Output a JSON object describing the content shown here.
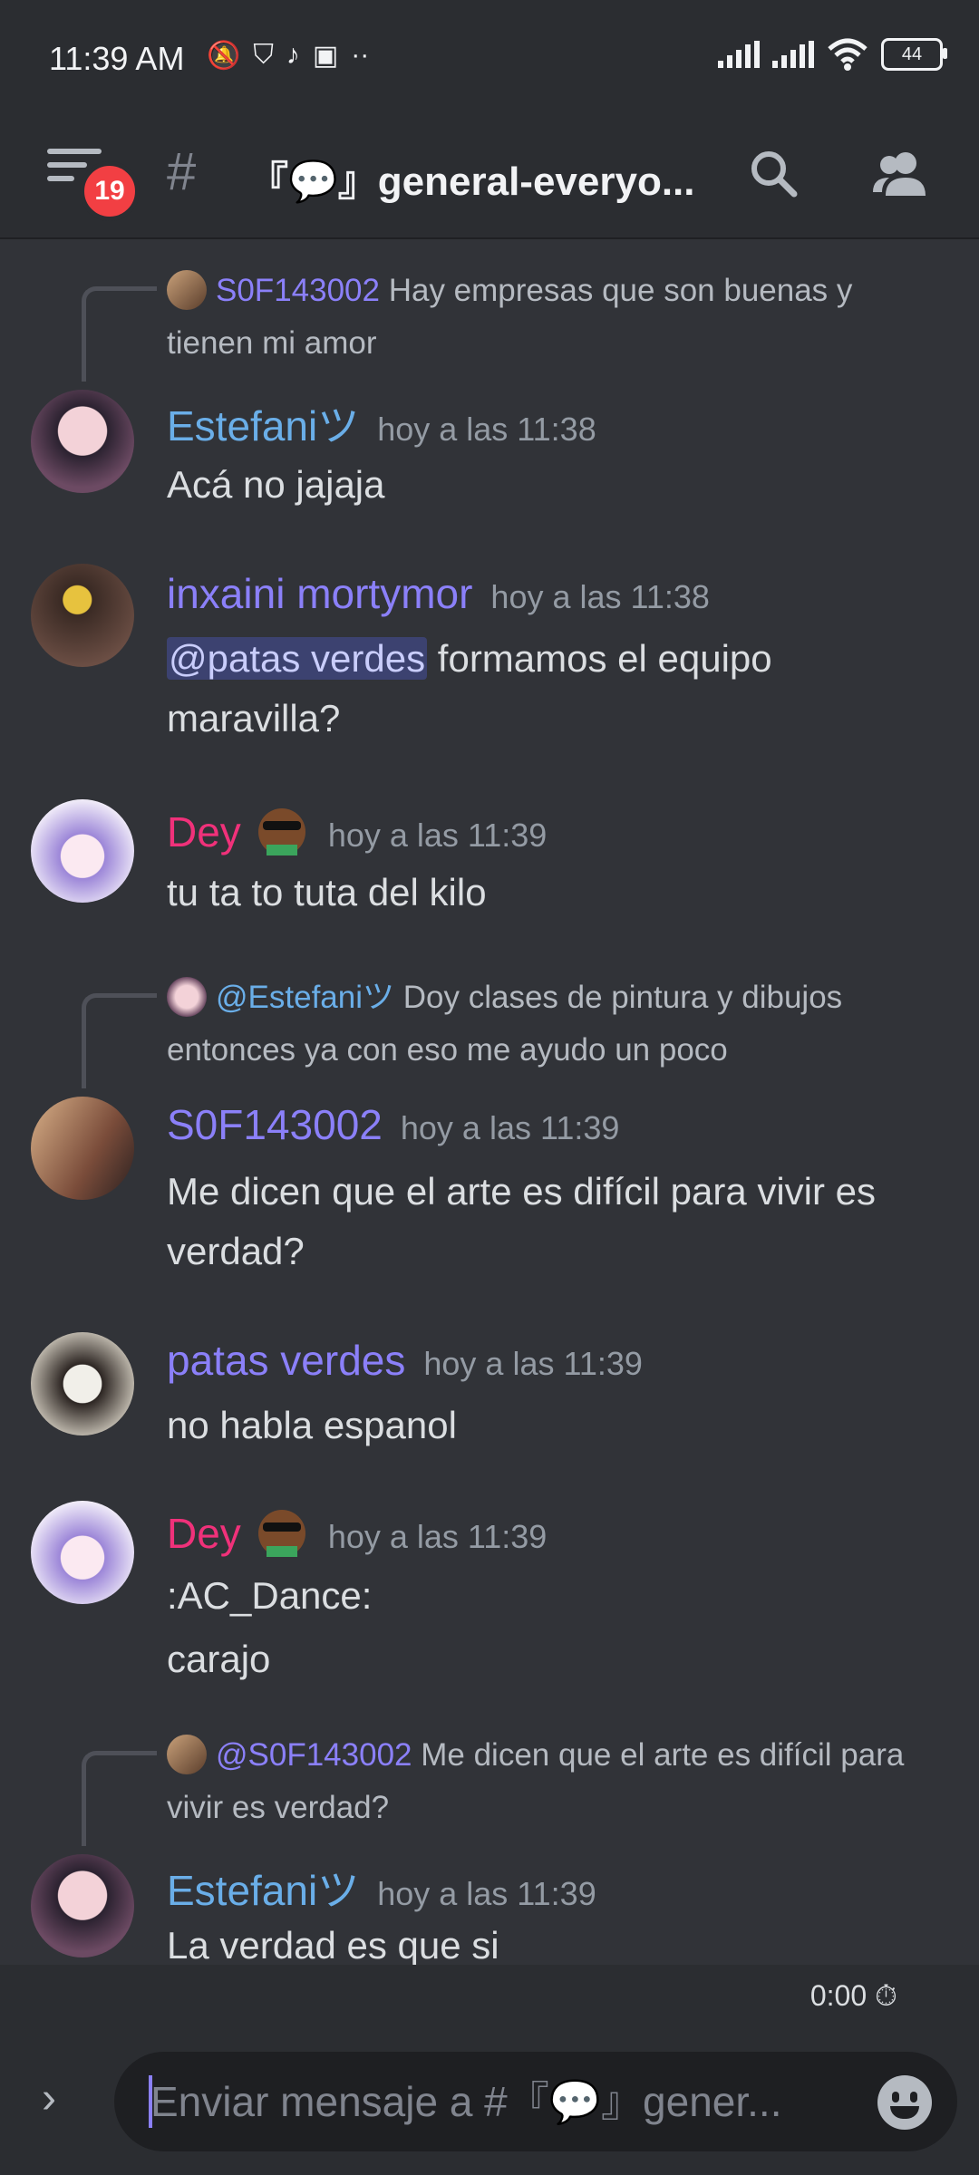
{
  "status_bar": {
    "time": "11:39 AM",
    "battery": "44",
    "icons": [
      "bell-off-icon",
      "vpn-shield-icon",
      "tiktok-icon",
      "twitch-icon",
      "more-dots-icon",
      "signal-icon",
      "signal-icon",
      "wifi-icon",
      "battery-icon"
    ]
  },
  "header": {
    "unread_badge": "19",
    "channel_prefix": "#",
    "channel_name": "『💬』general-everyo...",
    "icons": [
      "menu-icon",
      "search-icon",
      "members-icon"
    ]
  },
  "messages": [
    {
      "reply_to": {
        "name": "S0F143002",
        "text": "Hay empresas que son buenas y tienen mi amor"
      },
      "author": "Estefaniツ",
      "author_color": "#6aaee8",
      "timestamp": "hoy a las 11:38",
      "lines": [
        "Acá no jajaja"
      ]
    },
    {
      "author": "inxaini mortymor",
      "author_color": "#8b80f9",
      "timestamp": "hoy a las 11:38",
      "mention": "@patas verdes",
      "lines": [
        "formamos el equipo",
        "maravilla?"
      ]
    },
    {
      "author": "Dey",
      "author_color": "#f0317a",
      "timestamp": "hoy a las 11:39",
      "lines": [
        "tu ta to tuta del kilo"
      ]
    },
    {
      "reply_to": {
        "name": "@Estefaniツ",
        "text": "Doy clases de pintura y dibujos entonces ya con eso me ayudo un poco"
      },
      "author": "S0F143002",
      "author_color": "#8b80f9",
      "timestamp": "hoy a las 11:39",
      "lines": [
        "Me dicen que el arte es difícil para vivir es",
        "verdad?"
      ]
    },
    {
      "author": "patas verdes",
      "author_color": "#8b80f9",
      "timestamp": "hoy a las 11:39",
      "lines": [
        "no habla espanol"
      ]
    },
    {
      "author": "Dey",
      "author_color": "#f0317a",
      "timestamp": "hoy a las 11:39",
      "lines": [
        ":AC_Dance:",
        "carajo"
      ]
    },
    {
      "reply_to": {
        "name": "@S0F143002",
        "text": "Me dicen que el arte es difícil para vivir es verdad?"
      },
      "author": "Estefaniツ",
      "author_color": "#6aaee8",
      "timestamp": "hoy a las 11:39",
      "lines": [
        "La verdad es que si"
      ]
    }
  ],
  "composer": {
    "timer": "0:00",
    "placeholder": "Enviar mensaje a #『💬』gener..."
  }
}
